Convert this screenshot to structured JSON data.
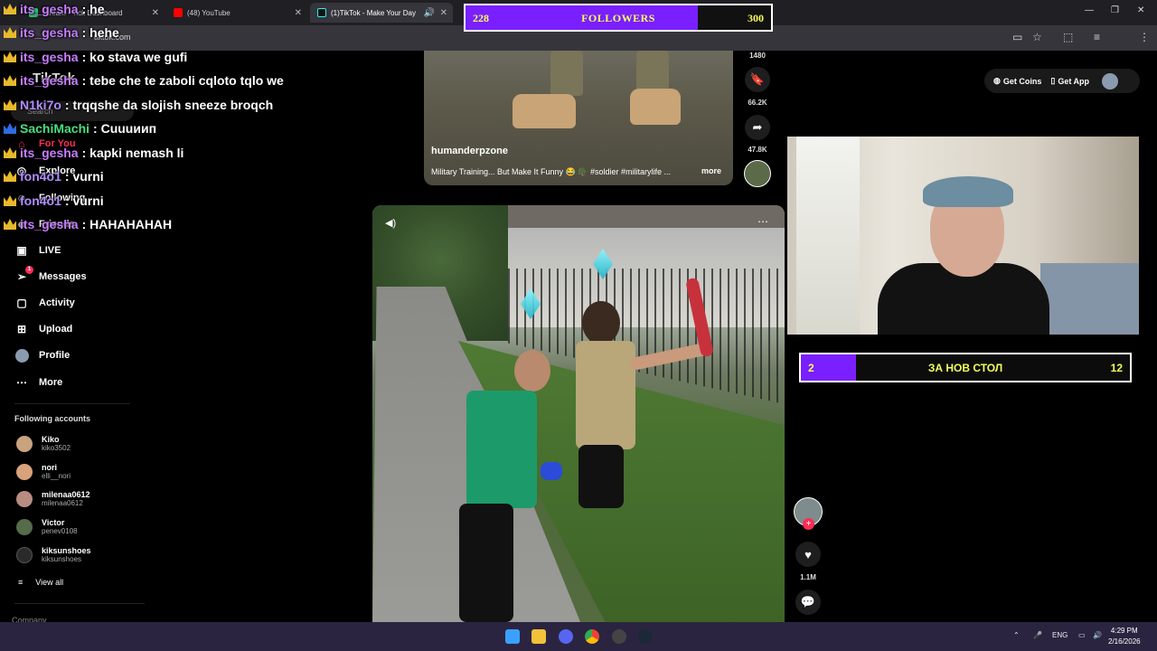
{
  "browser": {
    "tabs": [
      {
        "label": "Stream - Tick Dashboard"
      },
      {
        "label": "(48) YouTube"
      },
      {
        "label": "(1)TikTok - Make Your Day"
      }
    ],
    "url": "tiktok.com"
  },
  "tiktok": {
    "logo": "TikTok",
    "search_placeholder": "Search",
    "nav": [
      {
        "label": "For You",
        "icon": "home-icon"
      },
      {
        "label": "Explore",
        "icon": "compass-icon"
      },
      {
        "label": "Following",
        "icon": "following-icon"
      },
      {
        "label": "Friends",
        "icon": "friends-icon"
      },
      {
        "label": "LIVE",
        "icon": "live-icon"
      },
      {
        "label": "Messages",
        "icon": "send-icon",
        "badge": "1"
      },
      {
        "label": "Activity",
        "icon": "activity-icon"
      },
      {
        "label": "Upload",
        "icon": "plus-icon"
      },
      {
        "label": "Profile",
        "icon": "avatar-icon"
      },
      {
        "label": "More",
        "icon": "ellipsis-icon"
      }
    ],
    "following_title": "Following accounts",
    "following": [
      {
        "name": "Kiko",
        "user": "kiko3502"
      },
      {
        "name": "nori",
        "user": "elli__nori"
      },
      {
        "name": "milenaa0612",
        "user": "milenaa0612"
      },
      {
        "name": "Victor",
        "user": "penev0108"
      },
      {
        "name": "kiksunshoes",
        "user": "kiksunshoes"
      }
    ],
    "view_all": "View all",
    "company": "Company",
    "get_coins": "Get Coins",
    "get_app": "Get App",
    "video1": {
      "username": "humanderpzone",
      "description": "Military Training... But Make It Funny 😂 🪖 #soldier #militarylife ...",
      "more": "more",
      "count_top": "1480",
      "saves": "66.2K",
      "shares": "47.8K"
    },
    "video2": {
      "likes": "1.1M"
    }
  },
  "overlays": {
    "followers_goal": {
      "current": "228",
      "label": "FOLLOWERS",
      "target": "300",
      "progress": 0.76
    },
    "table_goal": {
      "current": "2",
      "label": "ЗА НОВ СТОЛ",
      "target": "12",
      "progress": 0.167
    }
  },
  "chat": [
    {
      "user": "its_gesha",
      "msg": "he",
      "color": "#c77dff"
    },
    {
      "user": "its_gesha",
      "msg": "hehe",
      "color": "#c77dff"
    },
    {
      "user": "its_gesha",
      "msg": "ko stava we gufi",
      "color": "#c77dff"
    },
    {
      "user": "its_gesha",
      "msg": "tebe che te zaboli cqloto tqlo we",
      "color": "#c77dff"
    },
    {
      "user": "N1ki7o",
      "msg": "trqqshe da slojish sneeze broqch",
      "color": "#b18cff"
    },
    {
      "user": "SachiMachi",
      "msg": "Сuuuиип",
      "color": "#4ade80"
    },
    {
      "user": "its_gesha",
      "msg": "kapki nemash li",
      "color": "#c77dff"
    },
    {
      "user": "fon4o1",
      "msg": "vurni",
      "color": "#b18cff"
    },
    {
      "user": "fon4o1",
      "msg": "vurni",
      "color": "#b18cff"
    },
    {
      "user": "its_gesha",
      "msg": "HAHAHAHAH",
      "color": "#c77dff"
    }
  ],
  "taskbar": {
    "lang": "ENG",
    "time": "4:29 PM",
    "date": "2/16/2026"
  }
}
